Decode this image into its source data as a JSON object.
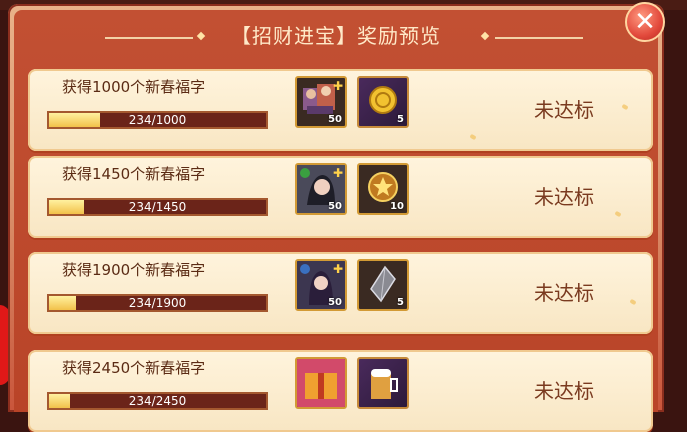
{
  "window": {
    "title": "【招财进宝】奖励预览",
    "close_icon": "close-icon"
  },
  "rewards": [
    {
      "label": "获得1000个新春福字",
      "progress": {
        "current": 234,
        "target": 1000,
        "text": "234/1000",
        "fraction": 0.234
      },
      "items": [
        {
          "icon": "hero-bundle-icon",
          "count": "50"
        },
        {
          "icon": "gold-coin-icon",
          "count": "5"
        }
      ],
      "status": "未达标"
    },
    {
      "label": "获得1450个新春福字",
      "progress": {
        "current": 234,
        "target": 1450,
        "text": "234/1450",
        "fraction": 0.161
      },
      "items": [
        {
          "icon": "hero-portrait-icon",
          "count": "50"
        },
        {
          "icon": "star-medal-icon",
          "count": "10"
        }
      ],
      "status": "未达标"
    },
    {
      "label": "获得1900个新春福字",
      "progress": {
        "current": 234,
        "target": 1900,
        "text": "234/1900",
        "fraction": 0.123
      },
      "items": [
        {
          "icon": "hero-portrait-icon",
          "count": "50"
        },
        {
          "icon": "crystal-shard-icon",
          "count": "5"
        }
      ],
      "status": "未达标"
    },
    {
      "label": "获得2450个新春福字",
      "progress": {
        "current": 234,
        "target": 2450,
        "text": "234/2450",
        "fraction": 0.096
      },
      "items": [
        {
          "icon": "gift-box-icon",
          "count": ""
        },
        {
          "icon": "beer-mug-icon",
          "count": ""
        }
      ],
      "status": "未达标"
    }
  ],
  "colors": {
    "accent": "#c25033",
    "card": "#fff4dd",
    "bar_fill": "#f2c14a",
    "bar_track": "#6b2419"
  }
}
